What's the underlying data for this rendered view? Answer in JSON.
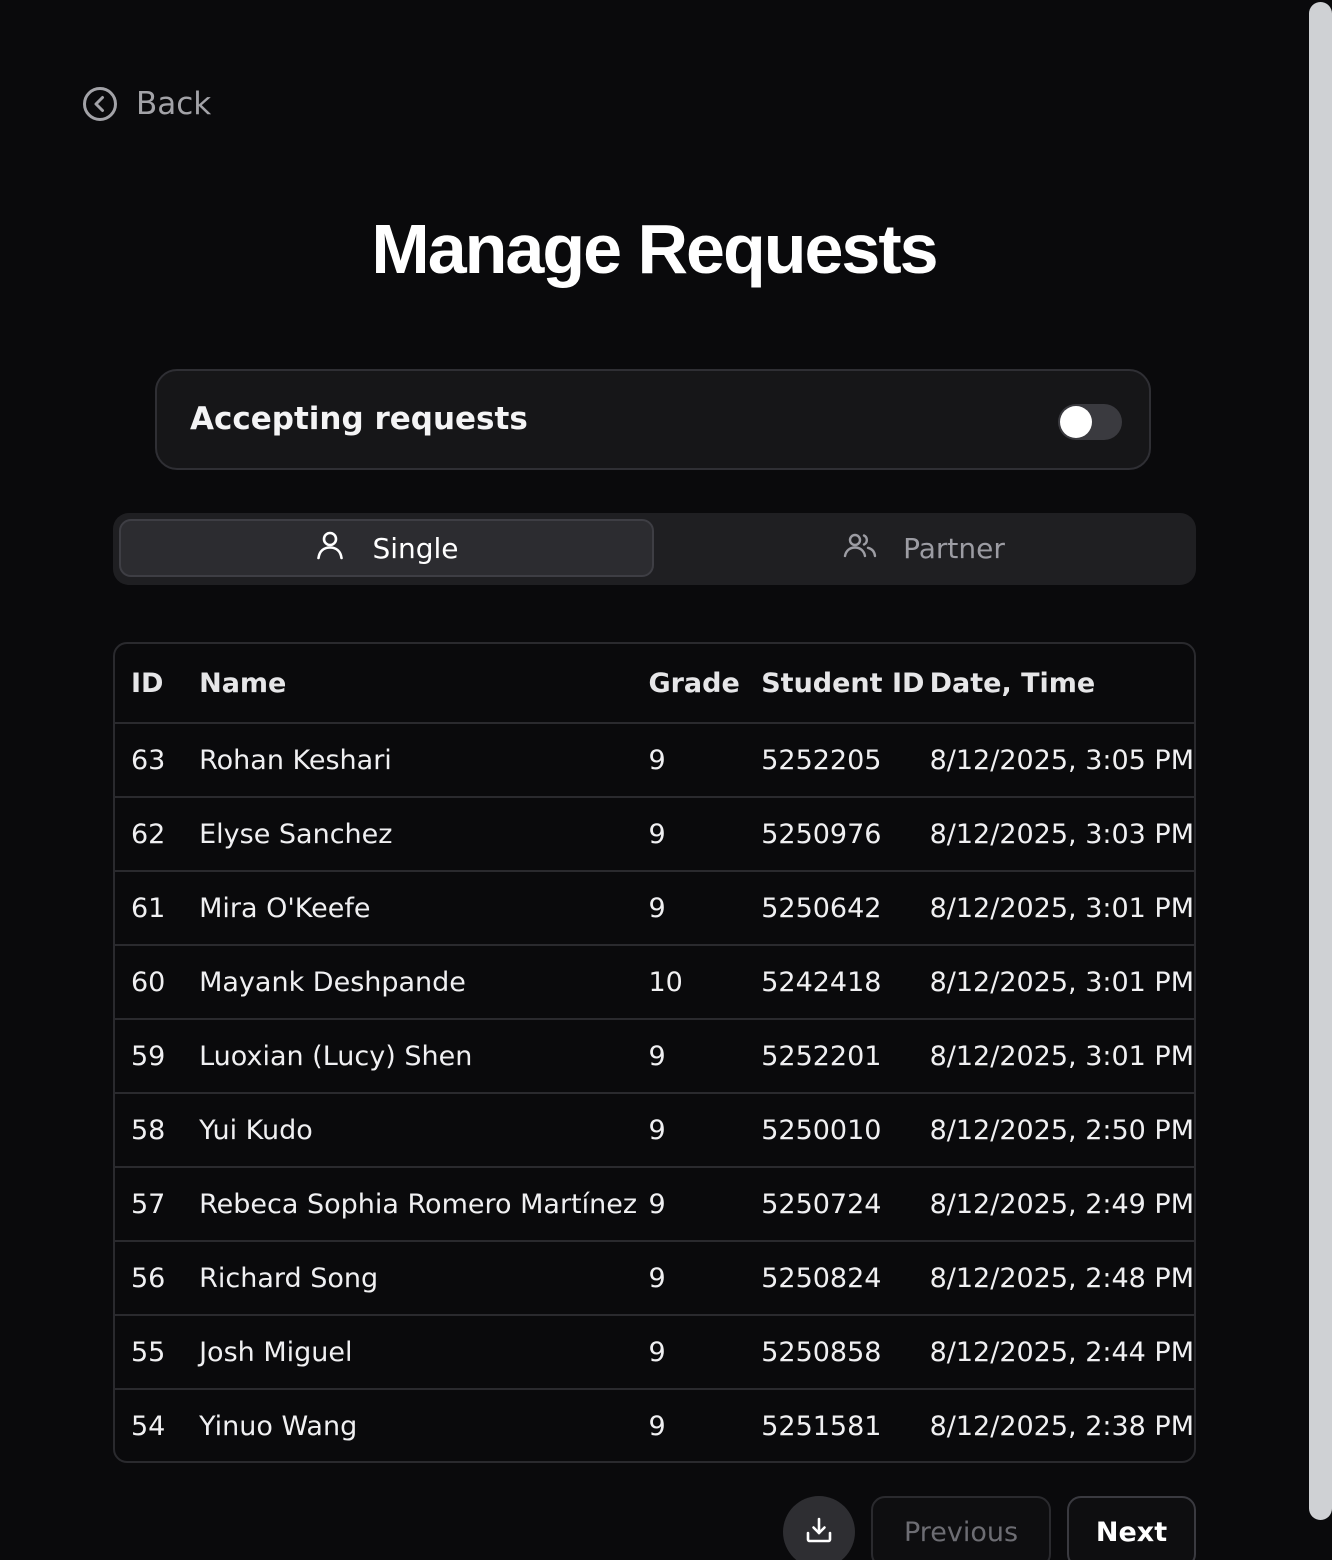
{
  "back": {
    "label": "Back",
    "icon": "chevron-left-circle-icon"
  },
  "page": {
    "title": "Manage Requests"
  },
  "accepting": {
    "label": "Accepting requests",
    "enabled": false
  },
  "tabs": [
    {
      "label": "Single",
      "icon": "user-icon",
      "active": true
    },
    {
      "label": "Partner",
      "icon": "users-icon",
      "active": false
    }
  ],
  "table": {
    "headers": [
      "ID",
      "Name",
      "Grade",
      "Student ID",
      "Date, Time"
    ],
    "rows": [
      [
        "63",
        "Rohan Keshari",
        "9",
        "5252205",
        "8/12/2025, 3:05 PM"
      ],
      [
        "62",
        "Elyse Sanchez",
        "9",
        "5250976",
        "8/12/2025, 3:03 PM"
      ],
      [
        "61",
        "Mira O'Keefe",
        "9",
        "5250642",
        "8/12/2025, 3:01 PM"
      ],
      [
        "60",
        "Mayank Deshpande",
        "10",
        "5242418",
        "8/12/2025, 3:01 PM"
      ],
      [
        "59",
        "Luoxian (Lucy) Shen",
        "9",
        "5252201",
        "8/12/2025, 3:01 PM"
      ],
      [
        "58",
        "Yui Kudo",
        "9",
        "5250010",
        "8/12/2025, 2:50 PM"
      ],
      [
        "57",
        "Rebeca Sophia Romero Martínez",
        "9",
        "5250724",
        "8/12/2025, 2:49 PM"
      ],
      [
        "56",
        "Richard Song",
        "9",
        "5250824",
        "8/12/2025, 2:48 PM"
      ],
      [
        "55",
        "Josh Miguel",
        "9",
        "5250858",
        "8/12/2025, 2:44 PM"
      ],
      [
        "54",
        "Yinuo Wang",
        "9",
        "5251581",
        "8/12/2025, 2:38 PM"
      ]
    ]
  },
  "pagination": {
    "download_icon": "download-icon",
    "previous_label": "Previous",
    "next_label": "Next"
  },
  "colors": {
    "background": "#0a0a0c",
    "card": "#161618",
    "border": "#2a2a2e",
    "text": "#ffffff",
    "muted": "#a3a3a8"
  }
}
